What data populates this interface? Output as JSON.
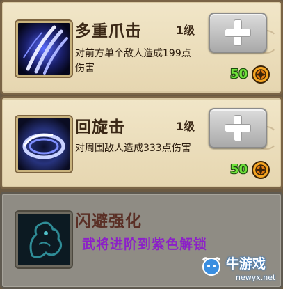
{
  "skills": [
    {
      "name": "多重爪击",
      "level": "1级",
      "description": "对前方单个敌人造成199点伤害",
      "cost": "50",
      "icon": "claw-slash-icon"
    },
    {
      "name": "回旋击",
      "level": "1级",
      "description": "对周围敌人造成333点伤害",
      "cost": "50",
      "icon": "whirl-strike-icon"
    }
  ],
  "locked_skill": {
    "name": "闪避强化",
    "unlock_hint": "武将进阶到紫色解锁",
    "icon": "dragon-silhouette-icon"
  },
  "watermark": {
    "title": "牛游戏",
    "url": "newyx.net"
  },
  "colors": {
    "cost_text": "#6fe23a",
    "unlock_hint": "#8c20c8",
    "panel_bg": "#efe3c4",
    "locked_bg": "#8f8c84"
  }
}
